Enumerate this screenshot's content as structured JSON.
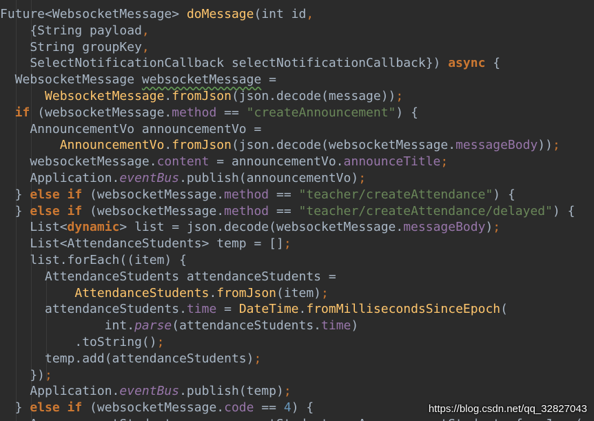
{
  "editor": {
    "theme_colors": {
      "background": "#2b2b2b",
      "plain": "#a9b7c6",
      "keyword": "#cc7832",
      "function": "#ffc66d",
      "string": "#6a8759",
      "field": "#9876aa",
      "number": "#6897bb"
    },
    "lines": [
      [
        [
          "pl",
          "Future<WebsocketMessage> "
        ],
        [
          "fn",
          "doMessage"
        ],
        [
          "pl",
          "(int id"
        ],
        [
          "pu",
          ","
        ]
      ],
      [
        [
          "pl",
          "    {String payload"
        ],
        [
          "pu",
          ","
        ]
      ],
      [
        [
          "pl",
          "    String groupKey"
        ],
        [
          "pu",
          ","
        ]
      ],
      [
        [
          "pl",
          "    SelectNotificationCallback selectNotificationCallback}) "
        ],
        [
          "kw",
          "async"
        ],
        [
          "pl",
          " {"
        ]
      ],
      [
        [
          "pl",
          "  WebsocketMessage "
        ],
        [
          "sq",
          "websocketMessage"
        ],
        [
          "pl",
          " ="
        ]
      ],
      [
        [
          "pl",
          "      "
        ],
        [
          "fn",
          "WebsocketMessage"
        ],
        [
          "pl",
          "."
        ],
        [
          "fn",
          "fromJson"
        ],
        [
          "pl",
          "(json.decode(message))"
        ],
        [
          "pu",
          ";"
        ]
      ],
      [
        [
          "kw",
          "  if"
        ],
        [
          "pl",
          " (websocketMessage."
        ],
        [
          "fd",
          "method"
        ],
        [
          "pl",
          " == "
        ],
        [
          "st",
          "\"createAnnouncement\""
        ],
        [
          "pl",
          ") {"
        ]
      ],
      [
        [
          "pl",
          "    AnnouncementVo announcementVo ="
        ]
      ],
      [
        [
          "pl",
          "        "
        ],
        [
          "fn",
          "AnnouncementVo"
        ],
        [
          "pl",
          "."
        ],
        [
          "fn",
          "fromJson"
        ],
        [
          "pl",
          "(json.decode(websocketMessage."
        ],
        [
          "fd",
          "messageBody"
        ],
        [
          "pl",
          "))"
        ],
        [
          "pu",
          ";"
        ]
      ],
      [
        [
          "pl",
          "    websocketMessage."
        ],
        [
          "fd",
          "content"
        ],
        [
          "pl",
          " = announcementVo."
        ],
        [
          "fd",
          "announceTitle"
        ],
        [
          "pu",
          ";"
        ]
      ],
      [
        [
          "pl",
          "    Application."
        ],
        [
          "it",
          "eventBus"
        ],
        [
          "pl",
          ".publish(announcementVo)"
        ],
        [
          "pu",
          ";"
        ]
      ],
      [
        [
          "pl",
          "  } "
        ],
        [
          "kw",
          "else if"
        ],
        [
          "pl",
          " (websocketMessage."
        ],
        [
          "fd",
          "method"
        ],
        [
          "pl",
          " == "
        ],
        [
          "st",
          "\"teacher/createAttendance\""
        ],
        [
          "pl",
          ") {"
        ]
      ],
      [
        [
          "pl",
          "  } "
        ],
        [
          "kw",
          "else if"
        ],
        [
          "pl",
          " (websocketMessage."
        ],
        [
          "fd",
          "method"
        ],
        [
          "pl",
          " == "
        ],
        [
          "st",
          "\"teacher/createAttendance/delayed\""
        ],
        [
          "pl",
          ") {"
        ]
      ],
      [
        [
          "pl",
          "    List<"
        ],
        [
          "kw",
          "dynamic"
        ],
        [
          "pl",
          "> list = json.decode(websocketMessage."
        ],
        [
          "fd",
          "messageBody"
        ],
        [
          "pl",
          ")"
        ],
        [
          "pu",
          ";"
        ]
      ],
      [
        [
          "pl",
          "    List<AttendanceStudents> temp = []"
        ],
        [
          "pu",
          ";"
        ]
      ],
      [
        [
          "pl",
          "    list.forEach((item) {"
        ]
      ],
      [
        [
          "pl",
          "      AttendanceStudents attendanceStudents ="
        ]
      ],
      [
        [
          "pl",
          "          "
        ],
        [
          "fn",
          "AttendanceStudents"
        ],
        [
          "pl",
          "."
        ],
        [
          "fn",
          "fromJson"
        ],
        [
          "pl",
          "(item)"
        ],
        [
          "pu",
          ";"
        ]
      ],
      [
        [
          "pl",
          "      attendanceStudents."
        ],
        [
          "fd",
          "time"
        ],
        [
          "pl",
          " = "
        ],
        [
          "fn",
          "DateTime"
        ],
        [
          "pl",
          "."
        ],
        [
          "fn",
          "fromMillisecondsSinceEpoch"
        ],
        [
          "pl",
          "("
        ]
      ],
      [
        [
          "pl",
          "              int."
        ],
        [
          "it",
          "parse"
        ],
        [
          "pl",
          "(attendanceStudents."
        ],
        [
          "fd",
          "time"
        ],
        [
          "pl",
          ")"
        ]
      ],
      [
        [
          "pl",
          "          .toString()"
        ],
        [
          "pu",
          ";"
        ]
      ],
      [
        [
          "pl",
          "      temp.add(attendanceStudents)"
        ],
        [
          "pu",
          ";"
        ]
      ],
      [
        [
          "pl",
          "    })"
        ],
        [
          "pu",
          ";"
        ]
      ],
      [
        [
          "pl",
          "    Application."
        ],
        [
          "it",
          "eventBus"
        ],
        [
          "pl",
          ".publish(temp)"
        ],
        [
          "pu",
          ";"
        ]
      ],
      [
        [
          "pl",
          "  } "
        ],
        [
          "kw",
          "else if"
        ],
        [
          "pl",
          " (websocketMessage."
        ],
        [
          "fd",
          "code"
        ],
        [
          "pl",
          " == "
        ],
        [
          "nu",
          "4"
        ],
        [
          "pl",
          ") {"
        ]
      ],
      [
        [
          "pl",
          "    AnnouncementStudents announcementStudents = AnnouncementStudents.fromJson("
        ]
      ]
    ]
  },
  "watermark": {
    "text": "https://blog.csdn.net/qq_32827043"
  }
}
